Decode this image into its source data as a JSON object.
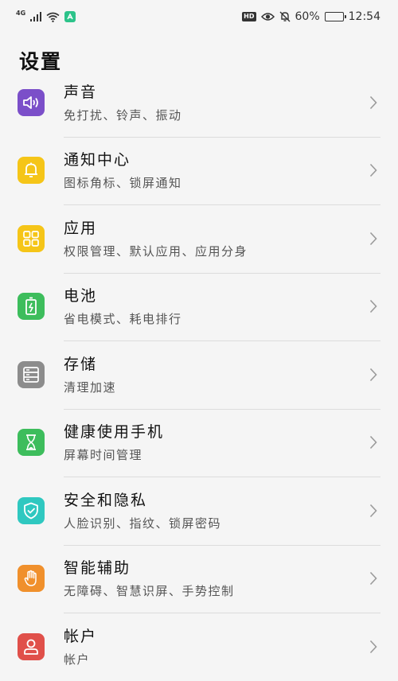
{
  "status": {
    "network": "4G",
    "hd": "HD",
    "battery_level": 0.6,
    "battery_text": "60%",
    "time": "12:54",
    "icons": [
      "signal-icon",
      "wifi-icon",
      "shortcut-app-icon",
      "hd-icon",
      "eye-comfort-icon",
      "mute-bell-icon",
      "battery-icon"
    ]
  },
  "page": {
    "title": "设置"
  },
  "items": [
    {
      "title": "声音",
      "subtitle": "免打扰、铃声、振动",
      "icon": "speaker-icon",
      "color": "#7b4fc9"
    },
    {
      "title": "通知中心",
      "subtitle": "图标角标、锁屏通知",
      "icon": "bell-icon",
      "color": "#f5c518"
    },
    {
      "title": "应用",
      "subtitle": "权限管理、默认应用、应用分身",
      "icon": "apps-grid-icon",
      "color": "#f5c518"
    },
    {
      "title": "电池",
      "subtitle": "省电模式、耗电排行",
      "icon": "battery-charge-icon",
      "color": "#3dbd5c"
    },
    {
      "title": "存储",
      "subtitle": "清理加速",
      "icon": "storage-icon",
      "color": "#8c8c8c"
    },
    {
      "title": "健康使用手机",
      "subtitle": "屏幕时间管理",
      "icon": "hourglass-icon",
      "color": "#3dbd5c"
    },
    {
      "title": "安全和隐私",
      "subtitle": "人脸识别、指纹、锁屏密码",
      "icon": "shield-icon",
      "color": "#2fc8c0"
    },
    {
      "title": "智能辅助",
      "subtitle": "无障碍、智慧识屏、手势控制",
      "icon": "hand-icon",
      "color": "#f0902c"
    },
    {
      "title": "帐户",
      "subtitle": "帐户",
      "icon": "person-icon",
      "color": "#e0504a"
    }
  ]
}
